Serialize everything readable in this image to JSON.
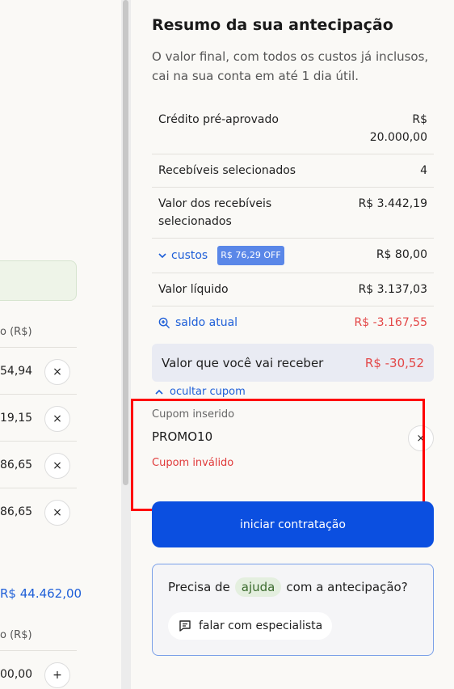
{
  "left_panel": {
    "column_header": "o (R$)",
    "rows": [
      "54,94",
      "19,15",
      "86,65",
      "86,65"
    ],
    "remove_icon": "×",
    "total": "R$ 44.462,00",
    "column_header_2": "o (R$)",
    "row_2": "00,00",
    "add_icon": "+"
  },
  "summary": {
    "title": "Resumo da sua antecipação",
    "subtitle": "O valor final, com todos os custos já inclusos, cai na sua conta em até 1 dia útil.",
    "rows": [
      {
        "label": "Crédito pré-aprovado",
        "value": "R$ 20.000,00"
      },
      {
        "label": "Recebíveis selecionados",
        "value": "4"
      },
      {
        "label": "Valor dos recebíveis selecionados",
        "value": "R$ 3.442,19"
      },
      {
        "label": "custos",
        "badge": "R$ 76,29 OFF",
        "value": "R$ 80,00"
      },
      {
        "label": "Valor líquido",
        "value": "R$ 3.137,03"
      },
      {
        "label": "saldo atual",
        "value": "R$ -3.167,55"
      }
    ],
    "receive_label": "Valor que você vai receber",
    "receive_value": "R$ -30,52"
  },
  "coupon": {
    "toggle_label": "ocultar cupom",
    "field_label": "Cupom inserido",
    "value": "PROMO10",
    "error": "Cupom inválido",
    "clear_icon": "×"
  },
  "cta": {
    "label": "iniciar contratação"
  },
  "help": {
    "prefix": "Precisa de",
    "chip": "ajuda",
    "suffix": "com a antecipação?",
    "button": "falar com especialista"
  },
  "colors": {
    "accent_blue": "#0b4fe0",
    "link_blue": "#1e5fd8",
    "negative_red": "#e34848",
    "highlight_red": "#ff0000"
  }
}
